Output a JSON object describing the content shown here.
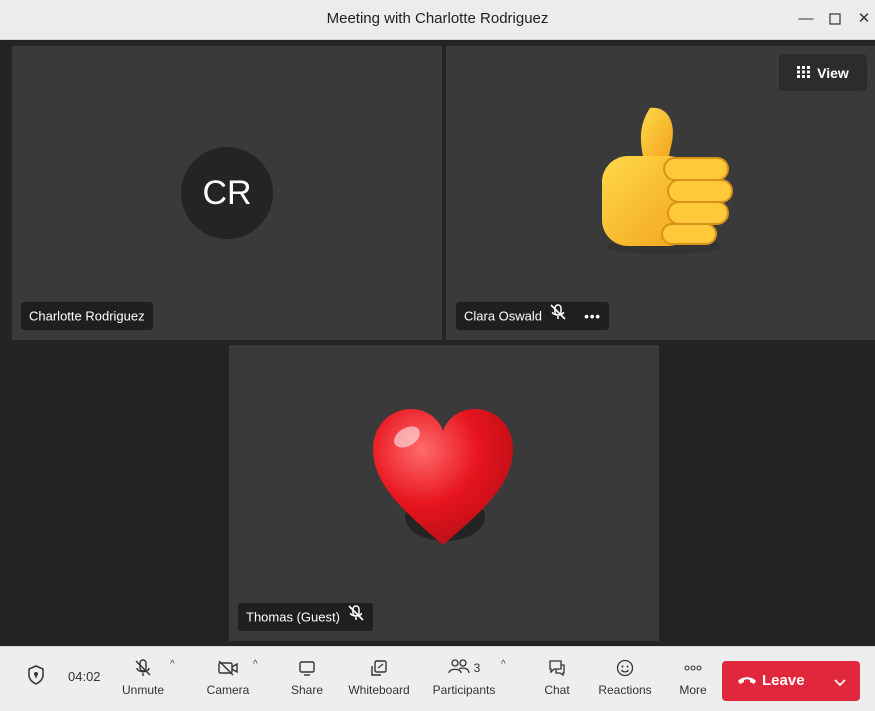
{
  "window": {
    "title": "Meeting with Charlotte Rodriguez",
    "controls": [
      "minimize-icon",
      "maximize-icon",
      "close-icon"
    ]
  },
  "view_button": {
    "label": "View",
    "icon": "grid-icon"
  },
  "participants": [
    {
      "name": "Charlotte Rodriguez",
      "initials": "CR",
      "muted": false
    },
    {
      "name": "Clara Oswald",
      "muted": true,
      "reaction": "thumbs-up",
      "has_more_menu": true
    },
    {
      "name": "Thomas (Guest)",
      "muted": true,
      "reaction": "heart"
    }
  ],
  "toolbar": {
    "timer": "04:02",
    "unmute_label": "Unmute",
    "camera_label": "Camera",
    "share_label": "Share",
    "whiteboard_label": "Whiteboard",
    "participants_label": "Participants",
    "participants_count": "3",
    "chat_label": "Chat",
    "reactions_label": "Reactions",
    "more_label": "More",
    "leave_label": "Leave"
  },
  "colors": {
    "leave": "#e0273b",
    "tile": "#3a3a3b",
    "stage": "#232425"
  }
}
